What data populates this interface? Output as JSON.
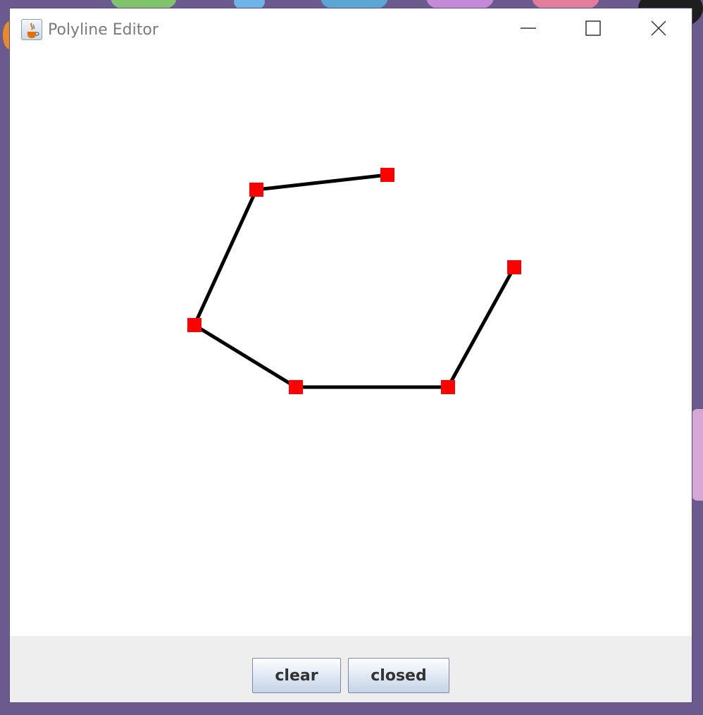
{
  "window": {
    "title": "Polyline Editor",
    "app_icon": "java-cup-icon",
    "controls": {
      "minimize_icon": "minimize-icon",
      "maximize_icon": "maximize-icon",
      "close_icon": "close-icon"
    }
  },
  "polyline": {
    "closed": false,
    "line_color": "#000000",
    "vertex_color": "#ff0000",
    "vertex_count": 6
  },
  "buttons": {
    "clear_label": "clear",
    "closed_label": "closed"
  },
  "colors": {
    "canvas_background": "#ffffff",
    "button_bar_background": "#eeeeee",
    "desktop_background": "#6a5a8e"
  }
}
